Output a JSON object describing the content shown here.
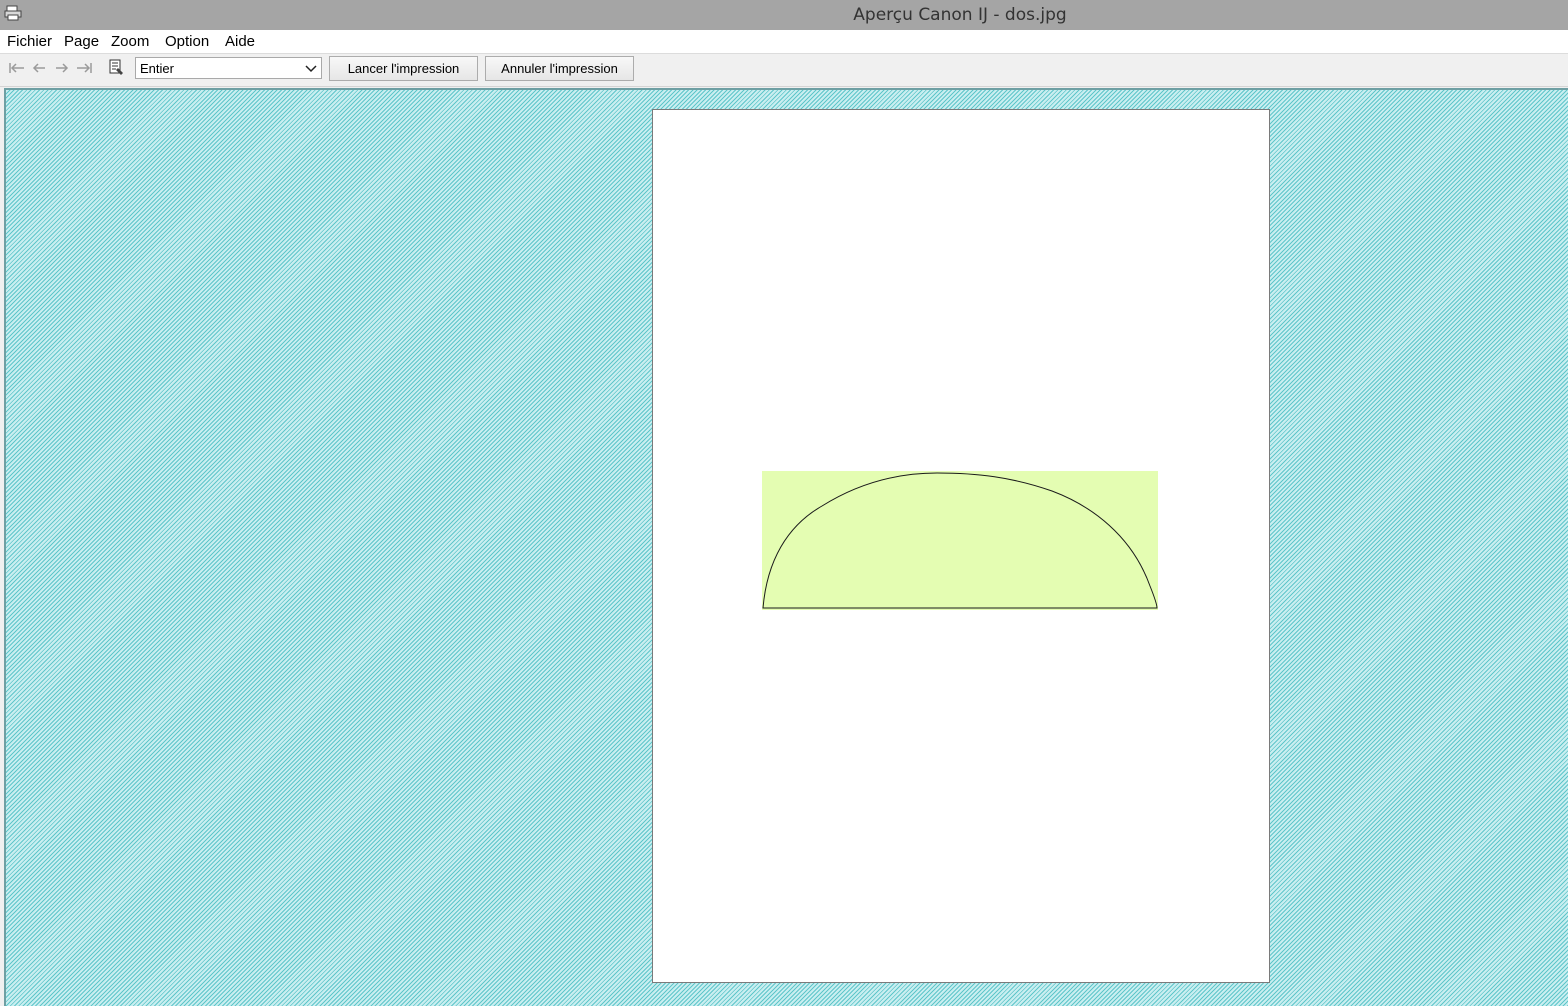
{
  "window": {
    "title": "Aperçu Canon IJ - dos.jpg"
  },
  "menu": {
    "items": [
      {
        "label": "Fichier"
      },
      {
        "label": "Page"
      },
      {
        "label": "Zoom"
      },
      {
        "label": "Option"
      },
      {
        "label": "Aide"
      }
    ]
  },
  "toolbar": {
    "nav_icons": [
      "first-page-icon",
      "previous-page-icon",
      "next-page-icon",
      "last-page-icon"
    ],
    "page_setup_icon": "print-settings-icon",
    "zoom_value": "Entier",
    "print_button": "Lancer l'impression",
    "cancel_button": "Annuler l'impression"
  },
  "preview": {
    "background_color": "#8fd9dc",
    "image_fill": "#e4fdb2",
    "image_outline": "#1a1a1a"
  }
}
